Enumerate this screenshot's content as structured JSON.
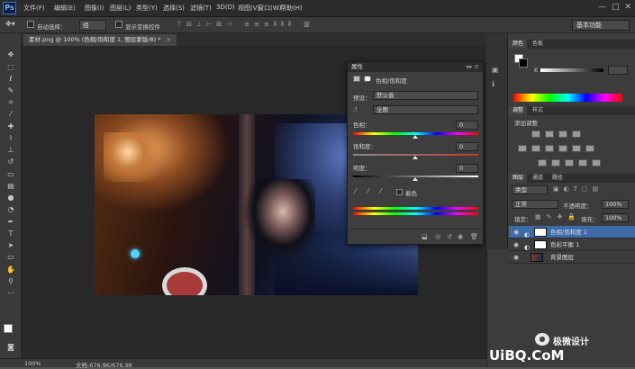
{
  "app": {
    "logo": "Ps"
  },
  "menu": [
    "文件(F)",
    "编辑(E)",
    "图像(I)",
    "图层(L)",
    "类型(Y)",
    "选择(S)",
    "滤镜(T)",
    "3D(D)",
    "视图(V)",
    "窗口(W)",
    "帮助(H)"
  ],
  "window_controls": {
    "minimize": "—",
    "maximize": "□",
    "close": "✕"
  },
  "options": {
    "auto_select_label": "自动选择：",
    "auto_select_value": "组",
    "show_transform_label": "显示变换控件",
    "workspace": "基本功能"
  },
  "document": {
    "tab_title": "素材.png @ 100% (色相/饱和度 1, 图层蒙版/8) *",
    "tab_close": "×"
  },
  "status": {
    "zoom": "100%",
    "doc_info": "文档:676.9K/676.9K"
  },
  "properties": {
    "title": "属性",
    "adj_name": "色相/饱和度",
    "preset_label": "预设：",
    "preset_value": "默认值",
    "channel_value": "全图",
    "hue_label": "色相：",
    "hue_value": "0",
    "saturation_label": "饱和度：",
    "saturation_value": "0",
    "lightness_label": "明度：",
    "lightness_value": "0",
    "colorize_label": "着色"
  },
  "color_panel": {
    "tabs": [
      "颜色",
      "色板"
    ],
    "k_label": "K",
    "fg": "#ffffff",
    "bg": "#000000"
  },
  "adjustments_panel": {
    "tabs": [
      "调整",
      "样式"
    ],
    "add_label": "添加调整"
  },
  "layers_panel": {
    "tabs": [
      "图层",
      "通道",
      "路径"
    ],
    "filter_kind": "类型",
    "blend_mode": "正常",
    "opacity_label": "不透明度：",
    "opacity_value": "100%",
    "lock_label": "锁定：",
    "fill_label": "填充：",
    "fill_value": "100%",
    "layers": [
      {
        "name": "色相/饱和度 1",
        "selected": true
      },
      {
        "name": "色彩平衡 1",
        "selected": false
      },
      {
        "name": "背景图层",
        "selected": false
      }
    ]
  },
  "watermark": {
    "brand": "极微设计",
    "site": "UiBQ.CoM"
  },
  "colors": {
    "accent_blue": "#3d6ba8",
    "menubar": "#2b2b2b",
    "panel": "#3c3c3c"
  }
}
